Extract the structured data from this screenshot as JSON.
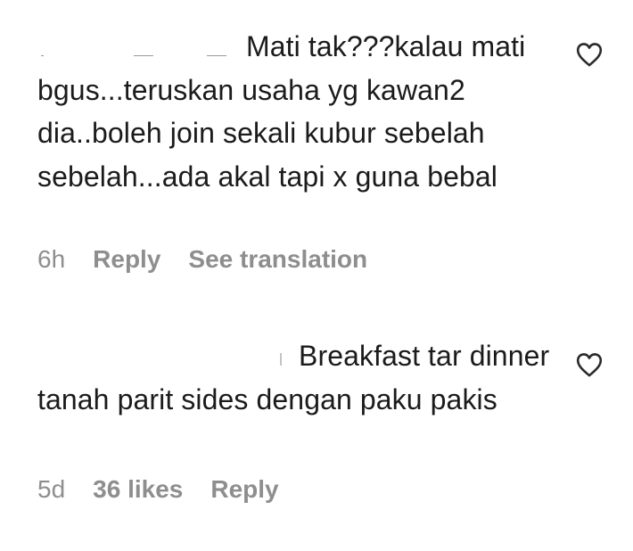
{
  "comments": [
    {
      "text": "Mati tak???kalau mati bgus...teruskan usaha yg kawan2 dia..boleh join sekali kubur sebelah sebelah...ada akal tapi x guna bebal",
      "time": "6h",
      "reply_label": "Reply",
      "translate_label": "See translation",
      "like_icon": "heart-outline-icon"
    },
    {
      "text": "Breakfast tar dinner tanah parit sides dengan paku pakis",
      "time": "5d",
      "likes_label": "36 likes",
      "reply_label": "Reply",
      "like_icon": "heart-outline-icon"
    }
  ]
}
